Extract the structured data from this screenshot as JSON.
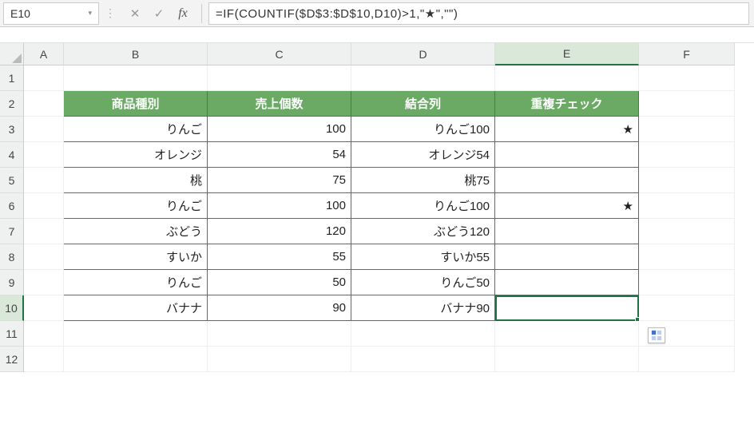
{
  "namebox": {
    "value": "E10"
  },
  "formula_bar": {
    "cancel_icon": "✕",
    "enter_icon": "✓",
    "fx_label": "fx",
    "formula": "=IF(COUNTIF($D$3:$D$10,D10)>1,\"★\",\"\")"
  },
  "columns": [
    "A",
    "B",
    "C",
    "D",
    "E",
    "F"
  ],
  "row_numbers": [
    "1",
    "2",
    "3",
    "4",
    "5",
    "6",
    "7",
    "8",
    "9",
    "10",
    "11",
    "12"
  ],
  "headers": {
    "B": "商品種別",
    "C": "売上個数",
    "D": "結合列",
    "E": "重複チェック"
  },
  "rows": [
    {
      "B": "りんご",
      "C": "100",
      "D": "りんご100",
      "E": "★"
    },
    {
      "B": "オレンジ",
      "C": "54",
      "D": "オレンジ54",
      "E": ""
    },
    {
      "B": "桃",
      "C": "75",
      "D": "桃75",
      "E": ""
    },
    {
      "B": "りんご",
      "C": "100",
      "D": "りんご100",
      "E": "★"
    },
    {
      "B": "ぶどう",
      "C": "120",
      "D": "ぶどう120",
      "E": ""
    },
    {
      "B": "すいか",
      "C": "55",
      "D": "すいか55",
      "E": ""
    },
    {
      "B": "りんご",
      "C": "50",
      "D": "りんご50",
      "E": ""
    },
    {
      "B": "バナナ",
      "C": "90",
      "D": "バナナ90",
      "E": ""
    }
  ],
  "colors": {
    "header_bg": "#6aaa64",
    "selection": "#217346"
  }
}
